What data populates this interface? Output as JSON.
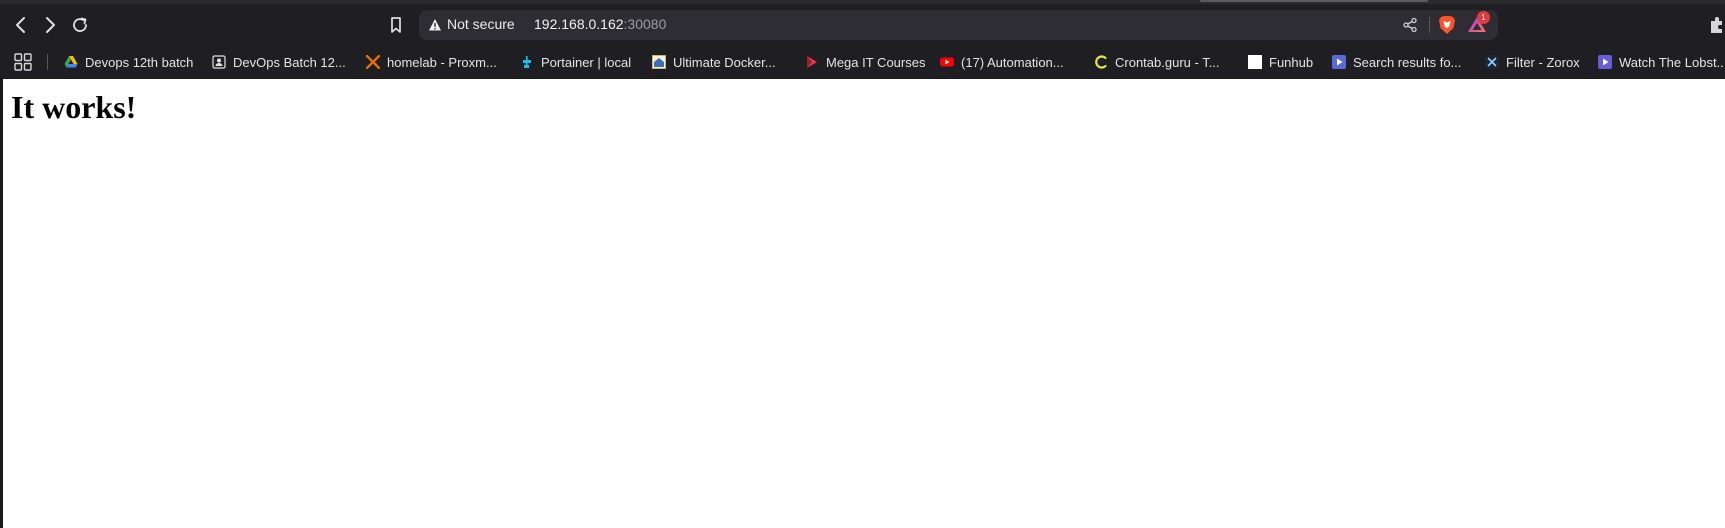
{
  "browser": {
    "security_label": "Not secure",
    "url_host": "192.168.0.162",
    "url_port": ":30080",
    "rewards_badge": "1",
    "icons": [
      "back-icon",
      "forward-icon",
      "reload-icon",
      "bookmark-icon",
      "warning-icon",
      "share-icon",
      "brave-shields-icon",
      "brave-rewards-icon",
      "extensions-icon",
      "apps-grid-icon"
    ]
  },
  "bookmarks": [
    {
      "label": "Devops 12th batch",
      "icon": "google-drive-icon"
    },
    {
      "label": "DevOps Batch 12...",
      "icon": "contact-card-icon"
    },
    {
      "label": "homelab - Proxm...",
      "icon": "proxmox-icon"
    },
    {
      "label": "Portainer | local",
      "icon": "portainer-icon"
    },
    {
      "label": "Ultimate Docker...",
      "icon": "course-icon"
    },
    {
      "label": "Mega IT Courses",
      "icon": "mega-courses-icon"
    },
    {
      "label": "(17) Automation...",
      "icon": "youtube-icon"
    },
    {
      "label": "Crontab.guru - T...",
      "icon": "crontab-icon"
    },
    {
      "label": "Funhub",
      "icon": "blank-page-icon"
    },
    {
      "label": "Search results fo...",
      "icon": "video-play-icon"
    },
    {
      "label": "Filter - Zorox",
      "icon": "zorox-icon"
    },
    {
      "label": "Watch The Lobst...",
      "icon": "video-play-icon"
    }
  ],
  "page": {
    "heading": "It works!"
  },
  "colors": {
    "chrome_bg": "#1f1f23",
    "urlbar_bg": "#2d2d33",
    "brave_orange": "#fb542b",
    "badge_red": "#e23b3b",
    "page_bg": "#ffffff"
  }
}
